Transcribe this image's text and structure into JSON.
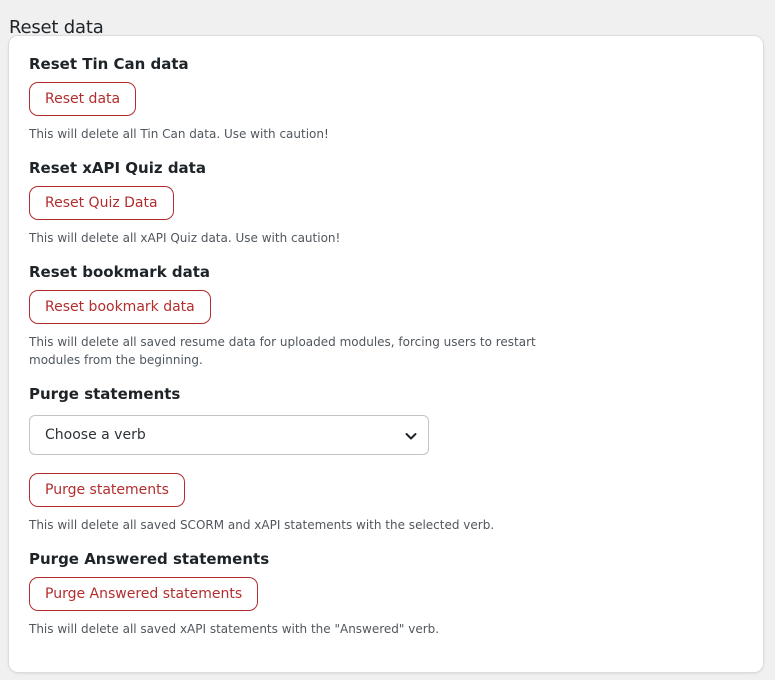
{
  "page": {
    "title": "Reset data"
  },
  "sections": {
    "tincan": {
      "heading": "Reset Tin Can data",
      "button_label": "Reset data",
      "description": "This will delete all Tin Can data. Use with caution!"
    },
    "quiz": {
      "heading": "Reset xAPI Quiz data",
      "button_label": "Reset Quiz Data",
      "description": "This will delete all xAPI Quiz data. Use with caution!"
    },
    "bookmark": {
      "heading": "Reset bookmark data",
      "button_label": "Reset bookmark data",
      "description": "This will delete all saved resume data for uploaded modules, forcing users to restart modules from the beginning."
    },
    "purge": {
      "heading": "Purge statements",
      "verb_select": {
        "selected": "Choose a verb"
      },
      "button_label": "Purge statements",
      "description": "This will delete all saved SCORM and xAPI statements with the selected verb."
    },
    "answered": {
      "heading": "Purge Answered statements",
      "button_label": "Purge Answered statements",
      "description": "This will delete all saved xAPI statements with the \"Answered\" verb."
    }
  },
  "icons": {
    "select_chevron": "chevron-down-icon"
  },
  "colors": {
    "danger": "#b32d2e",
    "background": "#f0f0f1",
    "card": "#ffffff"
  }
}
